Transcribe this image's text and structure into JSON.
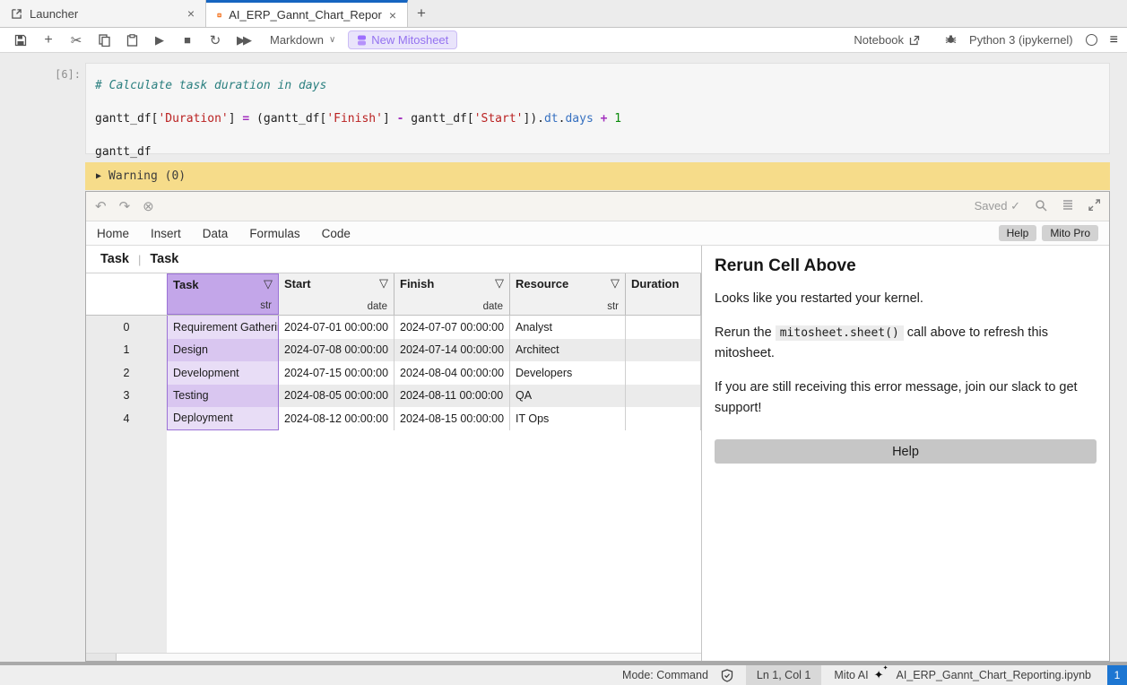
{
  "tabs": {
    "launcher": "Launcher",
    "notebook": "AI_ERP_Gannt_Chart_Repor",
    "close": "×",
    "add": "+"
  },
  "toolbar": {
    "cell_type": "Markdown",
    "new_mitosheet": "New Mitosheet",
    "notebook_label": "Notebook",
    "kernel": "Python 3 (ipykernel)"
  },
  "cell": {
    "prompt": "[6]:",
    "comment": "# Calculate task duration in days",
    "code2": {
      "t1": "gantt_df[",
      "s1": "'Duration'",
      "t2": "] ",
      "op1": "=",
      "t3": " (gantt_df[",
      "s2": "'Finish'",
      "t4": "] ",
      "op2": "-",
      "t5": " gantt_df[",
      "s3": "'Start'",
      "t6": "]).",
      "p1": "dt",
      "t7": ".",
      "p2": "days",
      "t8": " ",
      "op3": "+",
      "t9": " ",
      "n1": "1"
    },
    "line3": "gantt_df"
  },
  "warning": {
    "triangle": "▶",
    "label": "Warning (0)"
  },
  "mito": {
    "saved": "Saved",
    "saved_check": "✓",
    "menu": [
      "Home",
      "Insert",
      "Data",
      "Formulas",
      "Code"
    ],
    "help": "Help",
    "pro": "Mito Pro",
    "crumb_left": "Task",
    "crumb_right": "Task"
  },
  "table": {
    "columns": [
      {
        "name": "Task",
        "type": "str",
        "filter": true,
        "selected": true
      },
      {
        "name": "Start",
        "type": "date",
        "filter": true,
        "selected": false
      },
      {
        "name": "Finish",
        "type": "date",
        "filter": true,
        "selected": false
      },
      {
        "name": "Resource",
        "type": "str",
        "filter": true,
        "selected": false
      },
      {
        "name": "Duration",
        "type": "",
        "filter": false,
        "selected": false
      }
    ],
    "rows": [
      {
        "index": "0",
        "task": "Requirement Gathering",
        "start": "2024-07-01 00:00:00",
        "finish": "2024-07-07 00:00:00",
        "resource": "Analyst",
        "duration": ""
      },
      {
        "index": "1",
        "task": "Design",
        "start": "2024-07-08 00:00:00",
        "finish": "2024-07-14 00:00:00",
        "resource": "Architect",
        "duration": ""
      },
      {
        "index": "2",
        "task": "Development",
        "start": "2024-07-15 00:00:00",
        "finish": "2024-08-04 00:00:00",
        "resource": "Developers",
        "duration": ""
      },
      {
        "index": "3",
        "task": "Testing",
        "start": "2024-08-05 00:00:00",
        "finish": "2024-08-11 00:00:00",
        "resource": "QA",
        "duration": ""
      },
      {
        "index": "4",
        "task": "Deployment",
        "start": "2024-08-12 00:00:00",
        "finish": "2024-08-15 00:00:00",
        "resource": "IT Ops",
        "duration": ""
      }
    ]
  },
  "panel": {
    "title": "Rerun Cell Above",
    "p1": "Looks like you restarted your kernel.",
    "p2_pre": "Rerun the ",
    "p2_code": "mitosheet.sheet()",
    "p2_post": " call above to refresh this mitosheet.",
    "p3": "If you are still receiving this error message, join our slack to get support!",
    "help_button": "Help"
  },
  "statusbar": {
    "mode": "Mode: Command",
    "position": "Ln 1, Col 1",
    "mito_ai": "Mito AI",
    "filename": "AI_ERP_Gannt_Chart_Reporting.ipynb",
    "badge": "1"
  },
  "colors": {
    "accent_blue": "#1665c0",
    "selected_column_purple": "#c3a6e9",
    "warning_yellow": "#f6dc8a",
    "mito_purple": "#9472f0",
    "badge_blue": "#1d76d2"
  }
}
